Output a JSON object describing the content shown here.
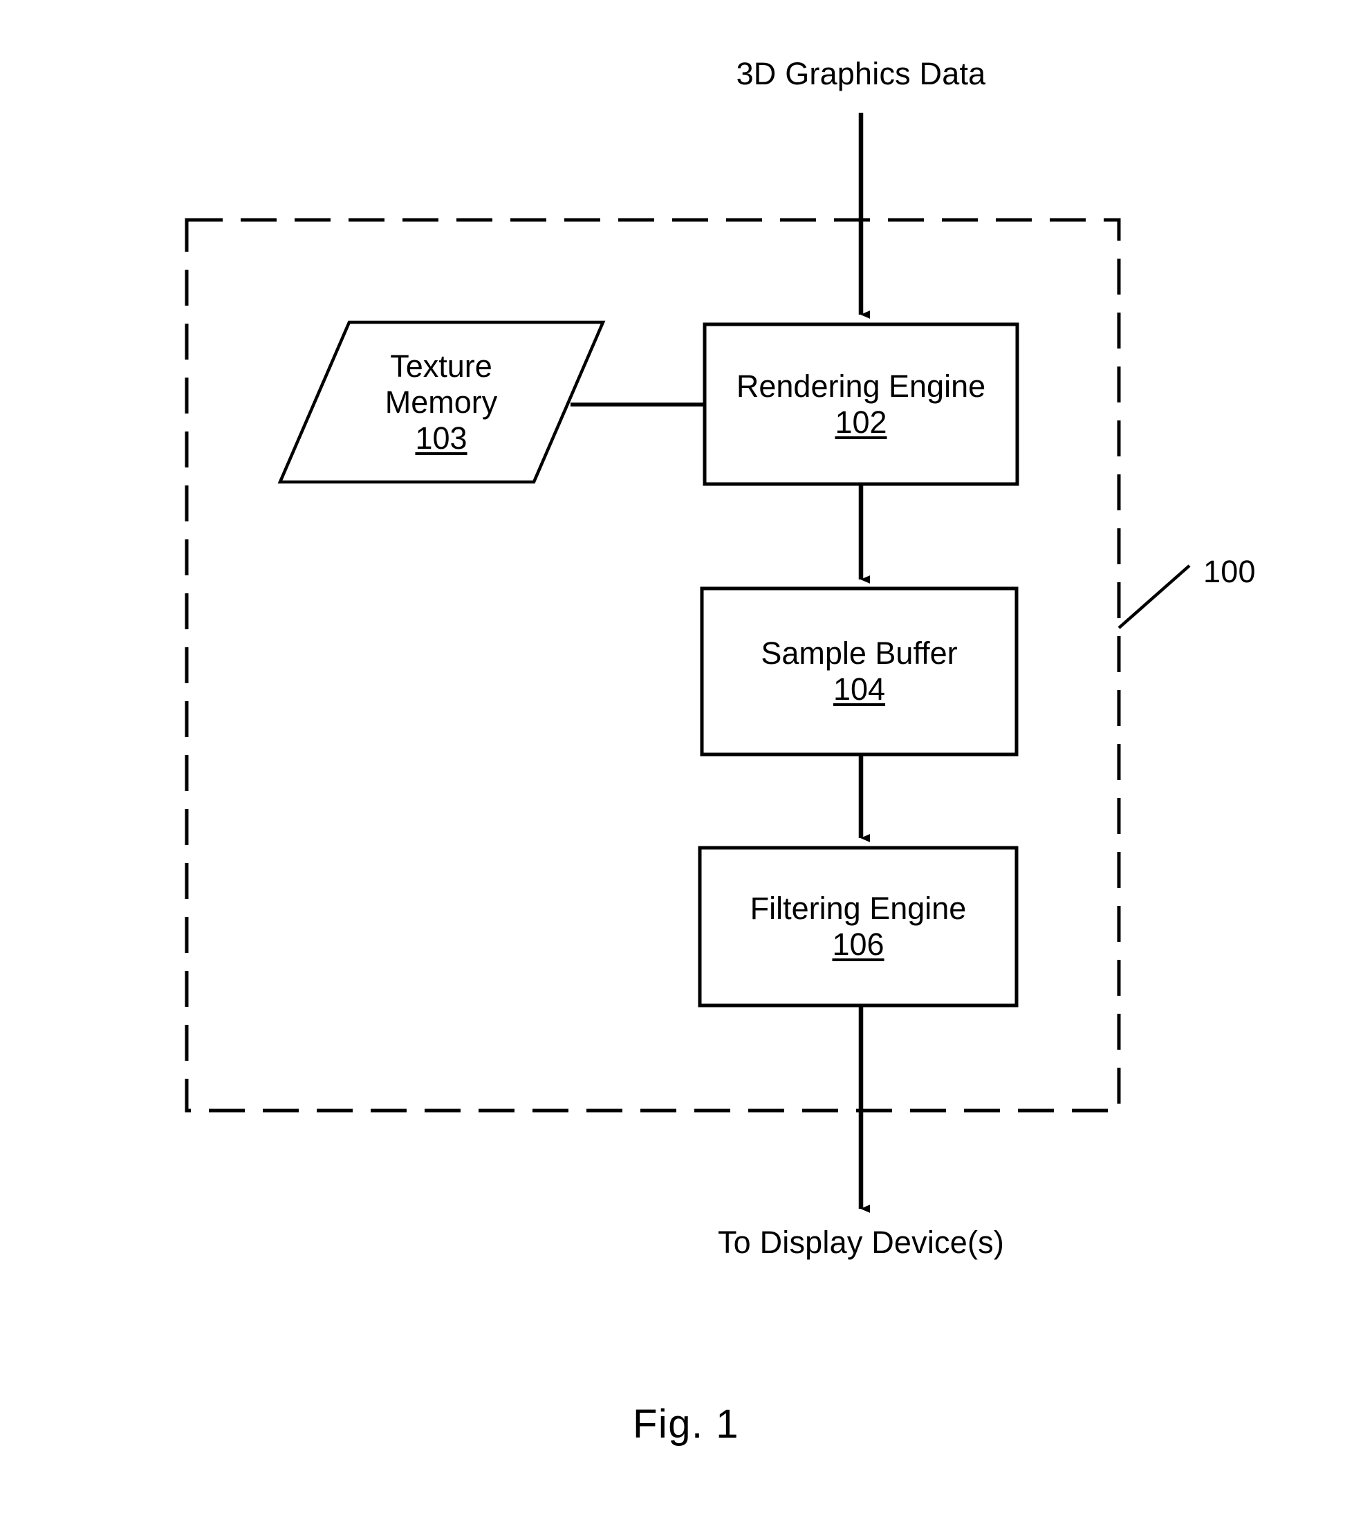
{
  "figure": {
    "caption": "Fig. 1",
    "system_callout": "100",
    "input_label": "3D Graphics Data",
    "output_label": "To Display Device(s)"
  },
  "nodes": [
    {
      "id": "texture-memory",
      "shape": "parallelogram",
      "title_line1": "Texture",
      "title_line2": "Memory",
      "ref": "103"
    },
    {
      "id": "rendering-engine",
      "shape": "rectangle",
      "title_line1": "Rendering Engine",
      "title_line2": "",
      "ref": "102"
    },
    {
      "id": "sample-buffer",
      "shape": "rectangle",
      "title_line1": "Sample Buffer",
      "title_line2": "",
      "ref": "104"
    },
    {
      "id": "filtering-engine",
      "shape": "rectangle",
      "title_line1": "Filtering Engine",
      "title_line2": "",
      "ref": "106"
    }
  ],
  "connections": [
    {
      "id": "input-to-rendering",
      "from": "3D Graphics Data",
      "to": "Rendering Engine",
      "arrow": true
    },
    {
      "id": "texture-to-rendering",
      "from": "Texture Memory",
      "to": "Rendering Engine",
      "arrow": false
    },
    {
      "id": "rendering-to-sample",
      "from": "Rendering Engine",
      "to": "Sample Buffer",
      "arrow": true
    },
    {
      "id": "sample-to-filtering",
      "from": "Sample Buffer",
      "to": "Filtering Engine",
      "arrow": true
    },
    {
      "id": "filtering-to-display",
      "from": "Filtering Engine",
      "to": "To Display Device(s)",
      "arrow": true
    }
  ],
  "colors": {
    "ink": "#000000",
    "paper": "#ffffff"
  }
}
